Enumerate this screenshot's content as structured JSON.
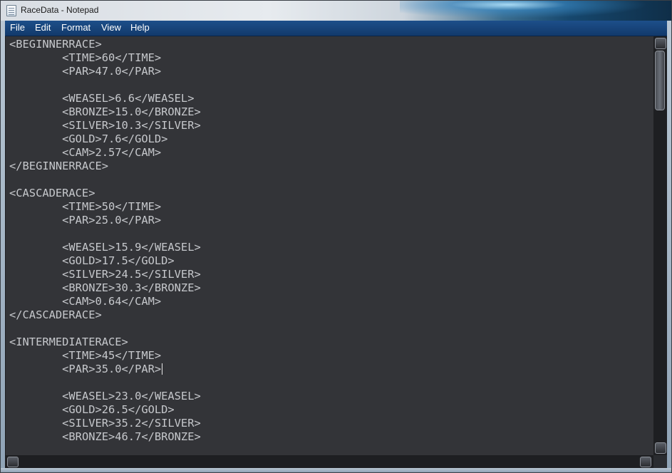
{
  "window": {
    "title": "RaceData - Notepad"
  },
  "menu": {
    "items": [
      "File",
      "Edit",
      "Format",
      "View",
      "Help"
    ]
  },
  "editor": {
    "lines_before_caret": "<BEGINNERRACE>\n\t<TIME>60</TIME>\n\t<PAR>47.0</PAR>\n\n\t<WEASEL>6.6</WEASEL>\n\t<BRONZE>15.0</BRONZE>\n\t<SILVER>10.3</SILVER>\n\t<GOLD>7.6</GOLD>\n\t<CAM>2.57</CAM>\n</BEGINNERRACE>\n\n<CASCADERACE>\n\t<TIME>50</TIME>\n\t<PAR>25.0</PAR>\n\n\t<WEASEL>15.9</WEASEL>\n\t<GOLD>17.5</GOLD>\n\t<SILVER>24.5</SILVER>\n\t<BRONZE>30.3</BRONZE>\n\t<CAM>0.64</CAM>\n</CASCADERACE>\n\n<INTERMEDIATERACE>\n\t<TIME>45</TIME>\n\t<PAR>35.0</PAR>",
    "lines_after_caret": "\n\n\t<WEASEL>23.0</WEASEL>\n\t<GOLD>26.5</GOLD>\n\t<SILVER>35.2</SILVER>\n\t<BRONZE>46.7</BRONZE>"
  },
  "colors": {
    "editor_bg": "#333438",
    "text": "#c6c8cc",
    "menubar": "#1d4f8a"
  }
}
